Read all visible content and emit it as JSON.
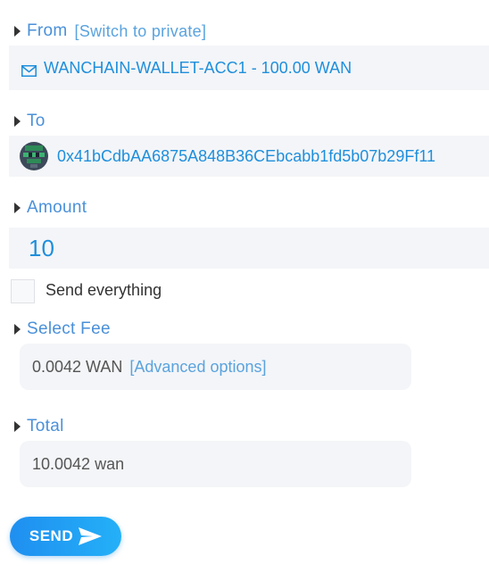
{
  "from": {
    "label": "From",
    "switch_link": "[Switch to private]",
    "account": "WANCHAIN-WALLET-ACC1 - 100.00 WAN",
    "icon": "mail-icon"
  },
  "to": {
    "label": "To",
    "address": "0x41bCdbAA6875A848B36CEbcabb1fd5b07b29Ff11",
    "icon": "identicon-avatar"
  },
  "amount": {
    "label": "Amount",
    "value": "10",
    "send_everything_label": "Send everything",
    "send_everything_checked": false
  },
  "fee": {
    "label": "Select Fee",
    "value": "0.0042 WAN",
    "advanced_link": "[Advanced options]"
  },
  "total": {
    "label": "Total",
    "value": "10.0042 wan"
  },
  "send_button": {
    "label": "SEND",
    "icon": "send-icon"
  },
  "colors": {
    "accent": "#1e8fdc",
    "label": "#4a90d9",
    "field_bg": "#f4f5f8"
  }
}
